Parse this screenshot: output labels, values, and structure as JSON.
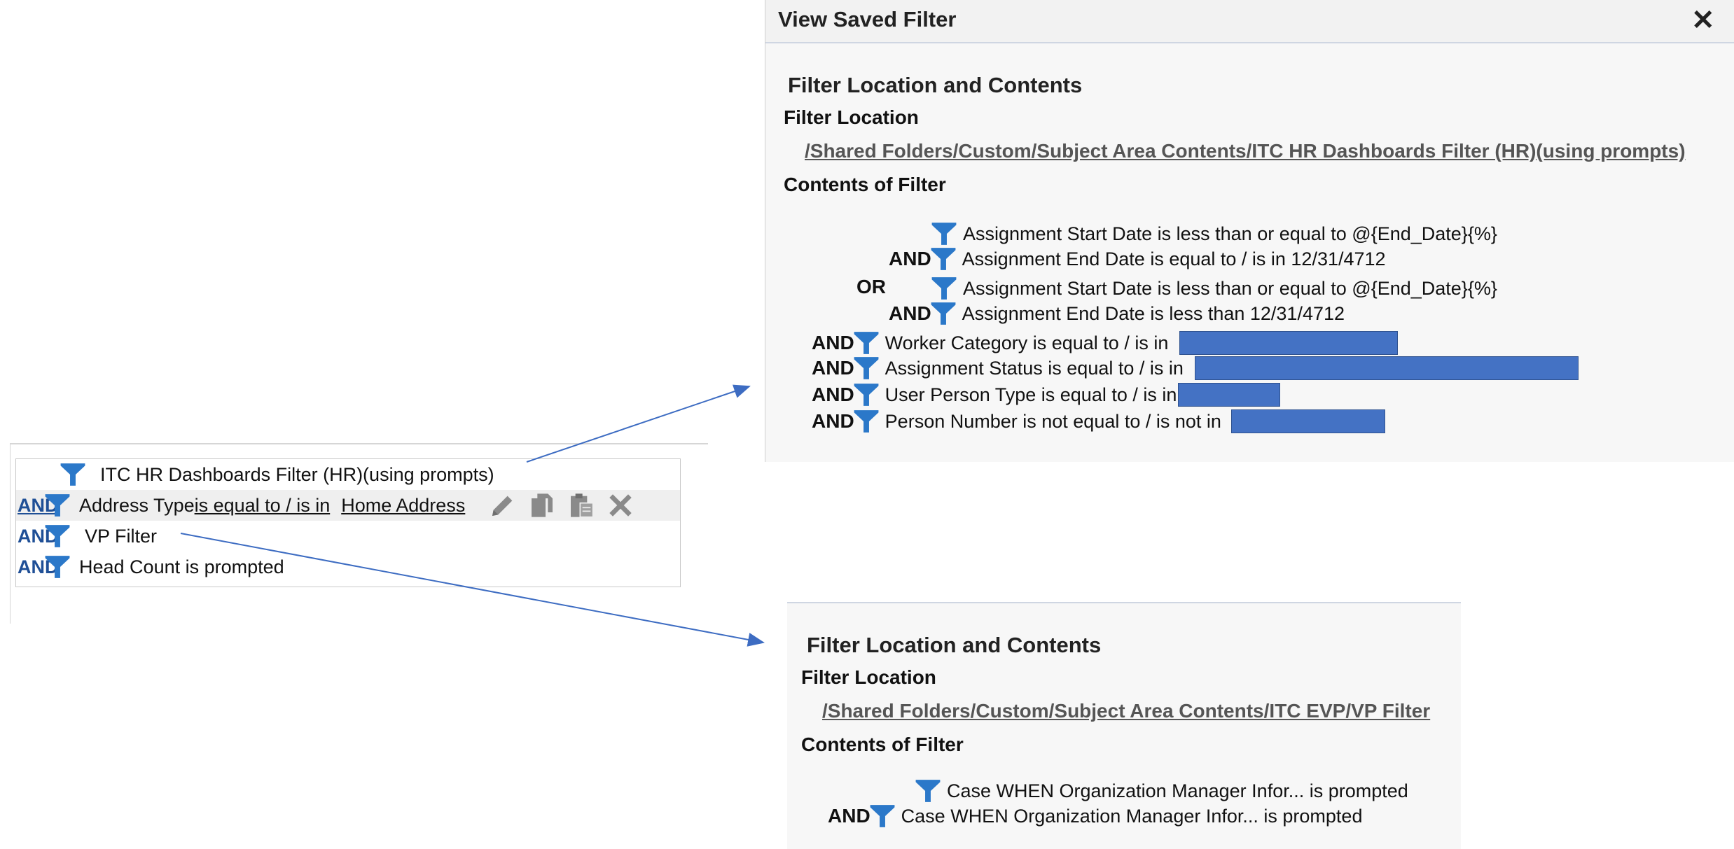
{
  "left_panel": {
    "rows": [
      {
        "connector": "",
        "label": "ITC HR Dashboards Filter (HR)(using prompts)"
      },
      {
        "connector": "AND",
        "label": "Address Type",
        "operator": " is equal to / is in",
        "value": "Home Address"
      },
      {
        "connector": "AND",
        "label": "VP Filter"
      },
      {
        "connector": "AND",
        "label": "Head Count is prompted"
      }
    ],
    "toolbar_icons": [
      "edit-icon",
      "copy-icon",
      "paste-icon",
      "delete-icon"
    ]
  },
  "dialog": {
    "title": "View Saved Filter",
    "close_label": "✕",
    "section_title": "Filter Location and Contents",
    "location_label": "Filter Location",
    "location_path": "/Shared Folders/Custom/Subject Area Contents/ITC HR Dashboards Filter (HR)(using prompts)",
    "contents_label": "Contents of Filter",
    "rows": [
      {
        "connector": "",
        "text": "Assignment Start Date  is less than or equal to  @{End_Date}{%}"
      },
      {
        "connector": "AND",
        "text": "Assignment End Date is equal to / is in  12/31/4712"
      },
      {
        "connector": "OR",
        "text": ""
      },
      {
        "connector": "",
        "text": "Assignment Start Date  is less than or equal to  @{End_Date}{%}"
      },
      {
        "connector": "AND",
        "text": "Assignment End Date  is less than  12/31/4712"
      },
      {
        "connector": "AND",
        "text": "Worker Category is equal to / is in"
      },
      {
        "connector": "AND",
        "text": "Assignment Status is equal to / is in"
      },
      {
        "connector": "AND",
        "text": "User Person Type is equal to / is in"
      },
      {
        "connector": "AND",
        "text": "Person Number is not equal to / is not in"
      }
    ]
  },
  "panel2": {
    "section_title": "Filter Location and Contents",
    "location_label": "Filter Location",
    "location_path": "/Shared Folders/Custom/Subject Area Contents/ITC EVP/VP Filter",
    "contents_label": "Contents of Filter",
    "rows": [
      {
        "connector": "",
        "text": "Case WHEN Organization Manager Infor... is prompted"
      },
      {
        "connector": "AND",
        "text": "Case WHEN Organization Manager Infor... is prompted"
      }
    ]
  },
  "colors": {
    "funnel": "#2b78c9",
    "redaction": "#4472c4",
    "arrow": "#3d6cc2",
    "and_link": "#1f4f96"
  }
}
